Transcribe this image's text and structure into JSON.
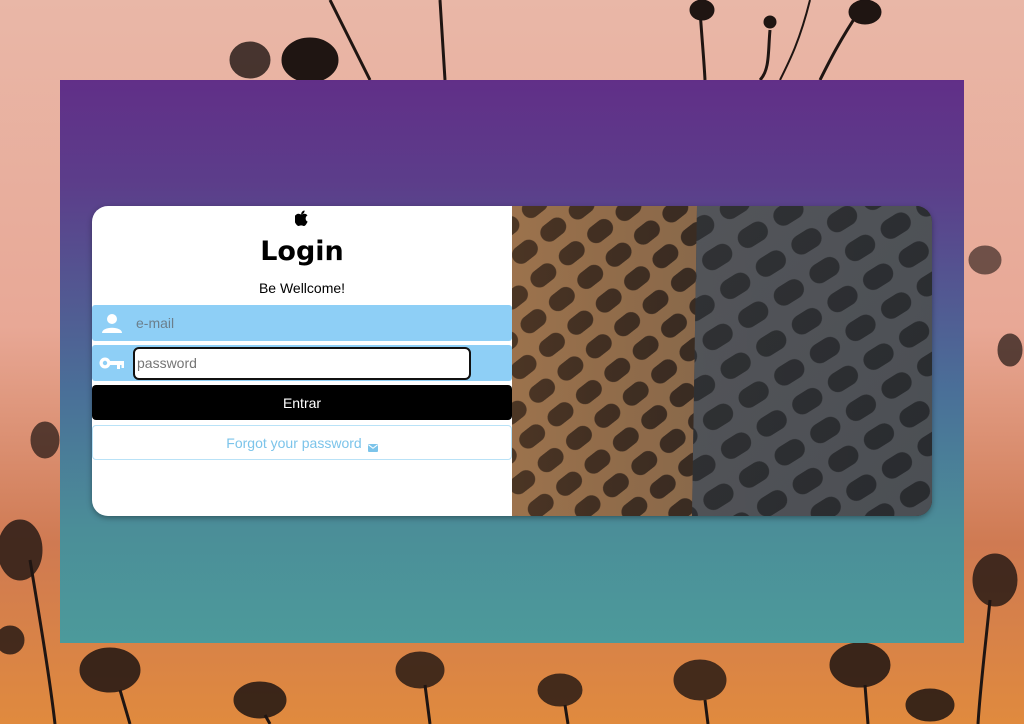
{
  "login": {
    "logo_icon": "apple-icon",
    "logo_glyph": "",
    "title": "Login",
    "subtitle": "Be Wellcome!",
    "email_placeholder": "e-mail",
    "email_icon": "user-icon",
    "password_placeholder": "password",
    "password_icon": "key-icon",
    "submit_label": "Entrar",
    "forgot_label": "Forgot your password",
    "forgot_icon": "mail-icon"
  },
  "colors": {
    "field_background": "#8ecff6",
    "button_background": "#000000",
    "link_color": "#7cc4ea",
    "panel_gradient_top": "#612f88",
    "panel_gradient_bottom": "#4c9a9b"
  },
  "images": {
    "right_panel": "architectural-facade-pattern"
  }
}
